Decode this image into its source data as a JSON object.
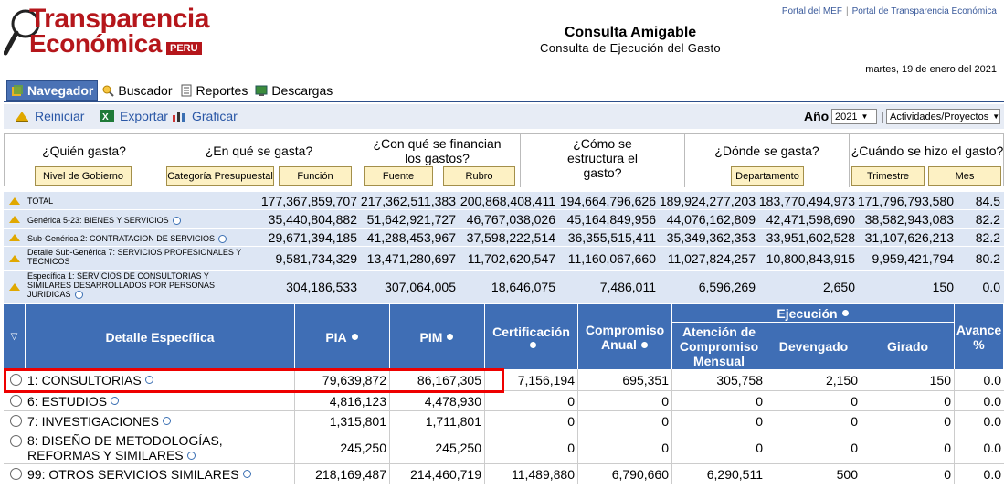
{
  "logo": {
    "line1": "Transparencia",
    "line2": "Económica",
    "badge": "PERU"
  },
  "top_links": [
    "Portal del MEF",
    "Portal de Transparencia Económica"
  ],
  "header": {
    "title": "Consulta Amigable",
    "subtitle": "Consulta de Ejecución del Gasto",
    "date": "martes, 19 de enero del 2021"
  },
  "tabs": [
    {
      "label": "Navegador",
      "icon": "cube-icon",
      "active": true
    },
    {
      "label": "Buscador",
      "icon": "search-icon"
    },
    {
      "label": "Reportes",
      "icon": "report-icon"
    },
    {
      "label": "Descargas",
      "icon": "download-icon"
    }
  ],
  "toolbar": {
    "reiniciar": "Reiniciar",
    "exportar": "Exportar",
    "graficar": "Graficar",
    "anio_label": "Año",
    "anio_value": "2021",
    "view_value": "Actividades/Proyectos",
    "sep": "|"
  },
  "questions": [
    {
      "q": "¿Quién gasta?",
      "buttons": [
        "Nivel de Gobierno"
      ]
    },
    {
      "q": "¿En qué se gasta?",
      "buttons": [
        "Categoría Presupuestal",
        "Función"
      ]
    },
    {
      "q": "¿Con qué se financian los gastos?",
      "buttons": [
        "Fuente",
        "Rubro"
      ]
    },
    {
      "q": "¿Cómo se estructura el gasto?",
      "buttons": []
    },
    {
      "q": "¿Dónde se gasta?",
      "buttons": [
        "Departamento"
      ]
    },
    {
      "q": "¿Cuándo se hizo el gasto?",
      "buttons": [
        "Trimestre",
        "Mes"
      ]
    }
  ],
  "summary": [
    {
      "label": "TOTAL",
      "values": [
        "177,367,859,707",
        "217,362,511,383",
        "200,868,408,411",
        "194,664,796,626",
        "189,924,277,203",
        "183,770,494,973",
        "171,796,793,580",
        "84.5"
      ]
    },
    {
      "label": "Genérica 5-23: BIENES Y SERVICIOS",
      "values": [
        "35,440,804,882",
        "51,642,921,727",
        "46,767,038,026",
        "45,164,849,956",
        "44,076,162,809",
        "42,471,598,690",
        "38,582,943,083",
        "82.2"
      ]
    },
    {
      "label": "Sub-Genérica 2: CONTRATACION DE SERVICIOS",
      "values": [
        "29,671,394,185",
        "41,288,453,967",
        "37,598,222,514",
        "36,355,515,411",
        "35,349,362,353",
        "33,951,602,528",
        "31,107,626,213",
        "82.2"
      ]
    },
    {
      "label": "Detalle Sub-Genérica 7: SERVICIOS PROFESIONALES Y TECNICOS",
      "values": [
        "9,581,734,329",
        "13,471,280,697",
        "11,702,620,547",
        "11,160,067,660",
        "11,027,824,257",
        "10,800,843,915",
        "9,959,421,794",
        "80.2"
      ]
    },
    {
      "label": "Específica 1: SERVICIOS DE CONSULTORIAS Y SIMILARES DESARROLLADOS POR PERSONAS JURIDICAS",
      "values": [
        "304,186,533",
        "307,064,005",
        "18,646,075",
        "7,486,011",
        "6,596,269",
        "2,650",
        "150",
        "0.0"
      ]
    }
  ],
  "table": {
    "headers": {
      "detalle": "Detalle Específica",
      "pia": "PIA",
      "pim": "PIM",
      "cert": "Certificación",
      "comp": "Compromiso Anual",
      "ejec": "Ejecución",
      "aten": "Atención de Compromiso Mensual",
      "dev": "Devengado",
      "gir": "Girado",
      "avance": "Avance %"
    },
    "rows": [
      {
        "name": "1: CONSULTORIAS",
        "values": [
          "79,639,872",
          "86,167,305",
          "7,156,194",
          "695,351",
          "305,758",
          "2,150",
          "150",
          "0.0"
        ]
      },
      {
        "name": "6: ESTUDIOS",
        "values": [
          "4,816,123",
          "4,478,930",
          "0",
          "0",
          "0",
          "0",
          "0",
          "0.0"
        ]
      },
      {
        "name": "7: INVESTIGACIONES",
        "values": [
          "1,315,801",
          "1,711,801",
          "0",
          "0",
          "0",
          "0",
          "0",
          "0.0"
        ]
      },
      {
        "name": "8: DISEÑO DE METODOLOGÍAS, REFORMAS Y SIMILARES",
        "values": [
          "245,250",
          "245,250",
          "0",
          "0",
          "0",
          "0",
          "0",
          "0.0"
        ]
      },
      {
        "name": "99: OTROS SERVICIOS SIMILARES",
        "values": [
          "218,169,487",
          "214,460,719",
          "11,489,880",
          "6,790,660",
          "6,290,511",
          "500",
          "0",
          "0.0"
        ]
      }
    ]
  }
}
